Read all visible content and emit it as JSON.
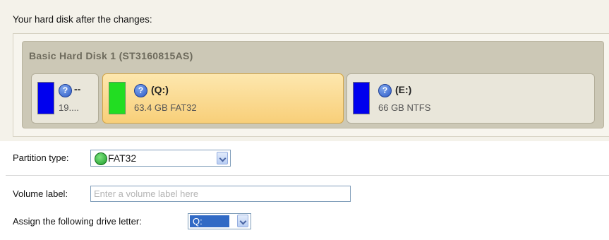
{
  "heading": "Your hard disk after the changes:",
  "disk": {
    "title": "Basic Hard Disk 1 (ST3160815AS)",
    "partitions": [
      {
        "name": "--",
        "info": "19....",
        "color": "#0000ee",
        "selected": false
      },
      {
        "name": "(Q:)",
        "info": "63.4 GB FAT32",
        "color": "#22dd22",
        "selected": true
      },
      {
        "name": "(E:)",
        "info": "66 GB NTFS",
        "color": "#0000ee",
        "selected": false
      }
    ]
  },
  "partition_type": {
    "label": "Partition type:",
    "value": "FAT32",
    "icon": "fat32-disk-icon"
  },
  "volume_label": {
    "label": "Volume label:",
    "value": "",
    "placeholder": "Enter a volume label here"
  },
  "drive_letter": {
    "label": "Assign the following drive letter:",
    "value": "Q:"
  },
  "colors": {
    "panel_bg": "#f4f2ea",
    "disk_bg": "#ccc8b6",
    "selected_accent": "#f8cf79",
    "selection_blue": "#316ac5"
  }
}
